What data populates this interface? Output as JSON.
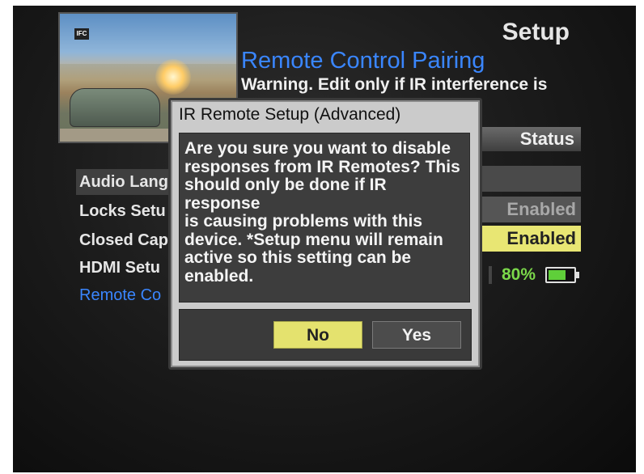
{
  "preview": {
    "channel_logo": "IFC"
  },
  "header": {
    "section_title": "Setup",
    "page_title": "Remote Control Pairing",
    "warning": "Warning. Edit only if IR interference is"
  },
  "status": {
    "header": "Status",
    "rows": [
      "Enabled",
      "Enabled"
    ],
    "battery_percent": "80%",
    "battery_level": 0.8
  },
  "menu": {
    "items": [
      {
        "label": "Audio Lang"
      },
      {
        "label": "Locks Setu"
      },
      {
        "label": "Closed Cap"
      },
      {
        "label": "HDMI Setu"
      },
      {
        "label": "Remote Co"
      }
    ]
  },
  "dialog": {
    "title": "IR Remote Setup (Advanced)",
    "message": "Are you sure you want to disable\nresponses from IR Remotes? This\nshould only be done if IR response\nis causing problems with this\ndevice. *Setup menu will remain\nactive so this setting can be\nenabled.",
    "no_label": "No",
    "yes_label": "Yes"
  },
  "colors": {
    "accent_blue": "#3a86ff",
    "highlight_yellow": "#e8e673",
    "battery_green": "#5fcf3a"
  }
}
